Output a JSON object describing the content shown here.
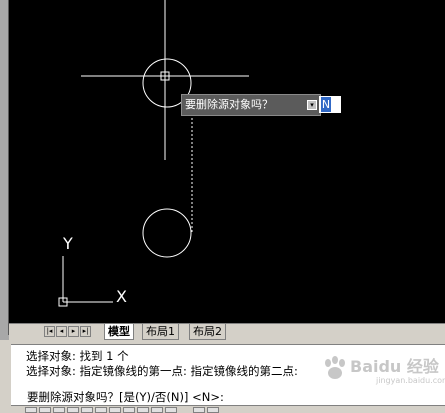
{
  "tooltip": {
    "text": "要删除源对象吗？"
  },
  "dynamic_input": {
    "value": "N"
  },
  "tabs": [
    {
      "label": "模型",
      "active": true
    },
    {
      "label": "布局1",
      "active": false
    },
    {
      "label": "布局2",
      "active": false
    }
  ],
  "ucs": {
    "y_label": "Y",
    "x_label": "X"
  },
  "command": {
    "history": [
      "选择对象: 找到 1 个",
      "选择对象:   指定镜像线的第一点: 指定镜像线的第二点:"
    ],
    "prompt": "要删除源对象吗？[是(Y)/否(N)] <N>:"
  },
  "watermark": {
    "text": "Baidu 经验",
    "sub": "jingyan.baidu.com"
  },
  "colors": {
    "canvas": "#000000",
    "drawing": "#ffffff",
    "selection": "#3169c6",
    "tooltip_bg": "#5b5b5b"
  }
}
